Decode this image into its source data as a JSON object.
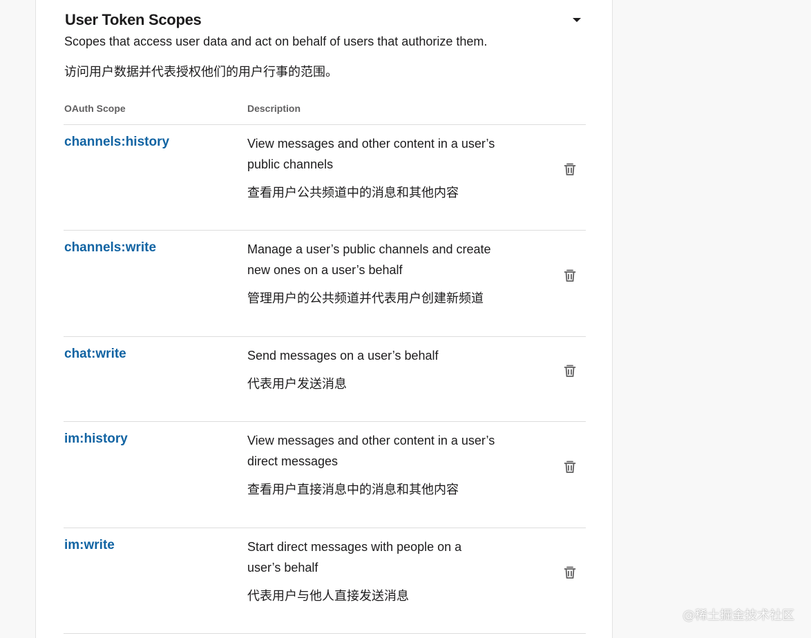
{
  "section": {
    "title": "User Token Scopes",
    "description_en": "Scopes that access user data and act on behalf of users that authorize them.",
    "description_zh": "访问用户数据并代表授权他们的用户行事的范围。",
    "collapse_icon": "caret-down-icon"
  },
  "table": {
    "headers": {
      "scope": "OAuth Scope",
      "description": "Description"
    },
    "rows": [
      {
        "scope": "channels:history",
        "desc_en": "View messages and other content in a user’s public channels",
        "desc_zh": "查看用户公共频道中的消息和其他内容",
        "action_icon": "trash-icon"
      },
      {
        "scope": "channels:write",
        "desc_en": "Manage a user’s public channels and create new ones on a user’s behalf",
        "desc_zh": "管理用户的公共频道并代表用户创建新频道",
        "action_icon": "trash-icon"
      },
      {
        "scope": "chat:write",
        "desc_en": "Send messages on a user’s behalf",
        "desc_zh": "代表用户发送消息",
        "action_icon": "trash-icon"
      },
      {
        "scope": "im:history",
        "desc_en": "View messages and other content in a user’s direct messages",
        "desc_zh": "查看用户直接消息中的消息和其他内容",
        "action_icon": "trash-icon"
      },
      {
        "scope": "im:write",
        "desc_en": "Start direct messages with people on a user’s behalf",
        "desc_zh": "代表用户与他人直接发送消息",
        "action_icon": "trash-icon"
      }
    ]
  },
  "watermark": "@稀土掘金技术社区",
  "colors": {
    "link": "#1264a3",
    "text": "#1d1c1d",
    "muted": "#616061",
    "page_bg": "#f8f8f8"
  }
}
